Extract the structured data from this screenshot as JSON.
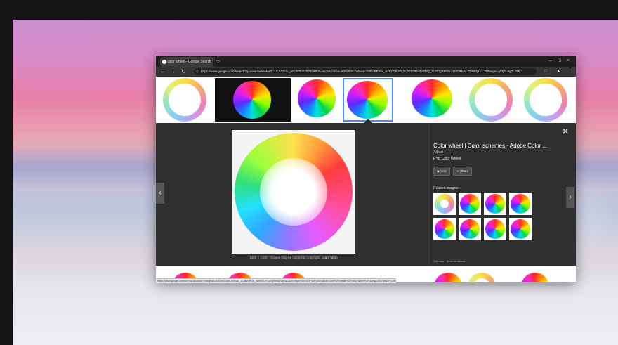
{
  "browser": {
    "tab_title": "color wheel - Google Search",
    "tab_close": "×",
    "new_tab": "+",
    "window_controls": [
      "–",
      "□",
      "×"
    ],
    "nav": {
      "back": "←",
      "forward": "→",
      "reload": "↻",
      "lock": "ⓘ"
    },
    "url": "https://www.google.com/search?q=color+wheel&rlz=1CAASUL_enUS764US764&tbm=isch&source=lnms&sa=X&ved=0ahUKEwia_JHYzP3cAhUKZOSOHaZvBfkQ_AUICigB&biw=1520&bih=733&dpr=1.75#imgrc=yt4jEr-9y7Lc9M:",
    "toolbar_icons": {
      "star": "☆",
      "extension": "▲",
      "menu": "⋮"
    }
  },
  "preview": {
    "image_size_caption": "1300 × 1300 - Images may be subject to copyright.",
    "learn_more": "Learn More",
    "prev_arrow": "‹",
    "next_arrow": "›",
    "close": "✕",
    "title": "Color wheel | Color schemes - Adobe Color ...",
    "site": "Adobe",
    "description": "RYB Color Wheel",
    "visit_label": "Visit",
    "share_label": "Share",
    "related_label": "Related images:",
    "footer_links": "Get help · Send feedback"
  },
  "status_bar": {
    "url": "https://www.google.com/url?sa=i&source=images&cd=&ved=2ahUKEwiD_ZLuBzcHVA_0DhhDOYCwQjh6egQIARAC&url=https%3A%2F%2Fcolor.adobe.com%2Fcreate%2Fcolor-wheel%2F&psig=AOvVaw3FY1qKRlbfhwE_bcvm&ust=1534967999223"
  }
}
